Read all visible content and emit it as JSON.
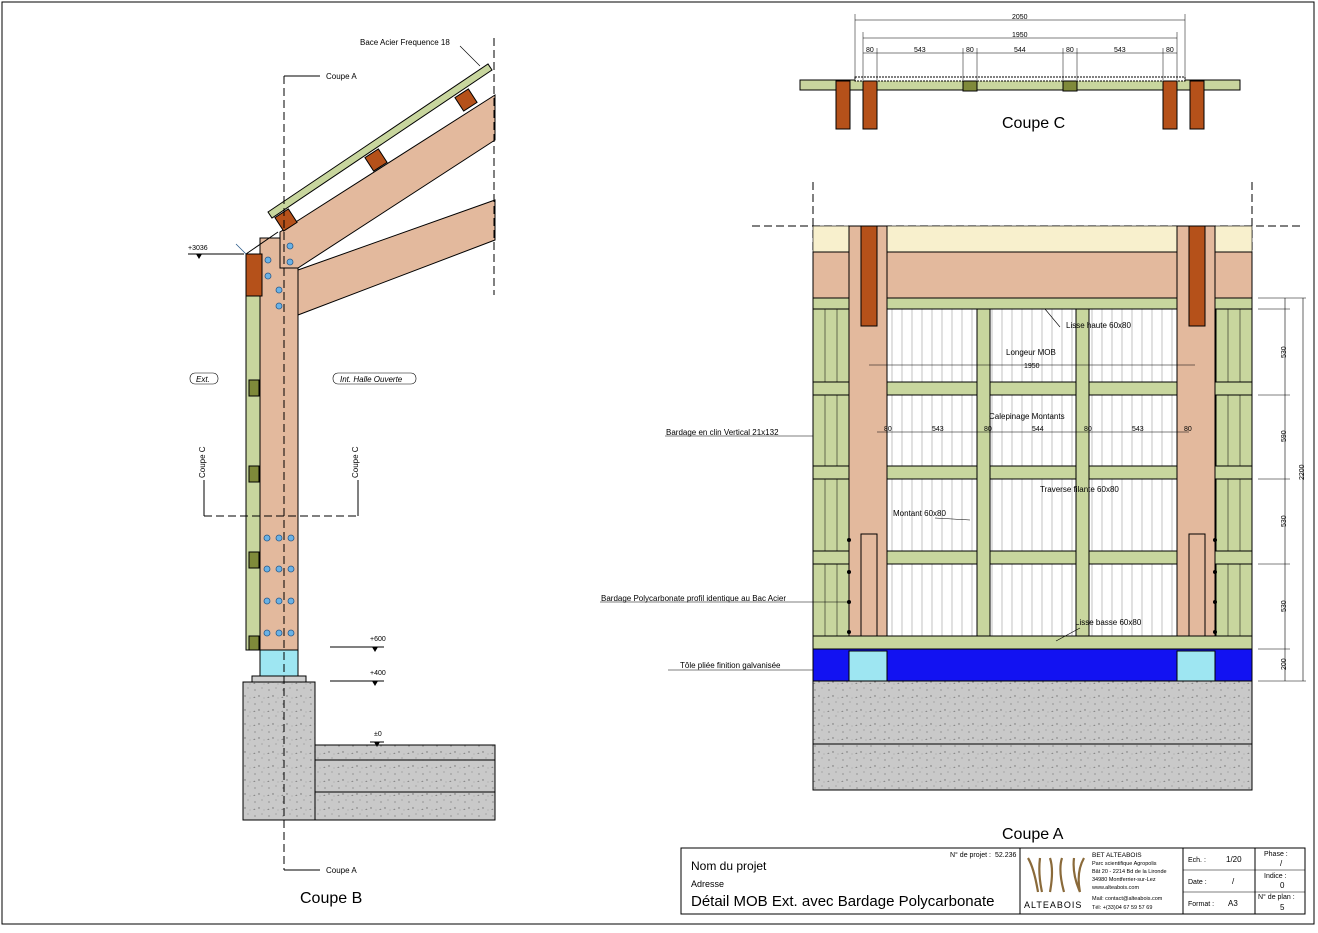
{
  "drawing": {
    "views": {
      "coupe_b": "Coupe B",
      "coupe_c": "Coupe C",
      "coupe_a": "Coupe A"
    },
    "section_marks": {
      "coupe_a": "Coupe A",
      "coupe_c": "Coupe C"
    },
    "coupe_b_labels": {
      "roof": "Bace Acier Frequence 18",
      "ext": "Ext.",
      "int": "Int. Halle Ouverte",
      "level_top": "+3036",
      "level_600": "+600",
      "level_400": "+400",
      "level_0": "±0"
    },
    "coupe_c_dims": {
      "total": "2050",
      "inner": "1950",
      "segments": [
        "80",
        "543",
        "80",
        "544",
        "80",
        "543",
        "80"
      ]
    },
    "coupe_a_labels": {
      "lisse_haute": "Lisse haute 60x80",
      "longueur_mob": "Longeur MOB",
      "longueur_val": "1950",
      "calepinage": "Calepinage Montants",
      "traverse": "Traverse filante 60x80",
      "montant": "Montant 60x80",
      "lisse_basse": "Lisse basse 60x80",
      "bardage_clin": "Bardage en clin Vertical 21x132",
      "bardage_poly": "Bardage Polycarbonate profil identique au Bac Acier",
      "tole": "Tôle pliée finition galvanisée",
      "calep_segments": [
        "80",
        "543",
        "80",
        "544",
        "80",
        "543",
        "80"
      ],
      "vertical_dims": [
        "530",
        "590",
        "530",
        "530",
        "200"
      ],
      "vertical_total": "2200"
    },
    "colors": {
      "wood": "#e3b99d",
      "wood_dark": "#b5511a",
      "frame_green": "#c8d69e",
      "frame_dark_green": "#7f8a3a",
      "poly_blue": "#1212f2",
      "plate_blue": "#9ee6f2",
      "concrete": "#c9c9c9",
      "upper_cream": "#f8f0cd",
      "bolt": "#6ab2e6"
    }
  },
  "title_block": {
    "project_label": "Nom du projet",
    "address_label": "Adresse",
    "title": "Détail MOB Ext. avec Bardage Polycarbonate",
    "project_no_label": "N° de projet :",
    "project_no": "52.236",
    "company": {
      "name": "BET  ALTEABOIS",
      "line1": "Parc scientifique Agropolis",
      "line2": "Bât 20 - 2214 Bd de la Lironde",
      "line3": "34980 Montferrier-sur-Lez",
      "web": "www.alteabois.com",
      "mail": "Mail: contact@alteabois.com",
      "tel": "Tél: +(33)04 67 59 57 69",
      "logo_text": "ALTEABOIS"
    },
    "scale_label": "Ech. :",
    "scale": "1/20",
    "date_label": "Date :",
    "date": "/",
    "format_label": "Format :",
    "format": "A3",
    "phase_label": "Phase :",
    "phase": "/",
    "indice_label": "Indice :",
    "indice": "0",
    "plan_label": "N° de plan :",
    "plan": "5"
  }
}
